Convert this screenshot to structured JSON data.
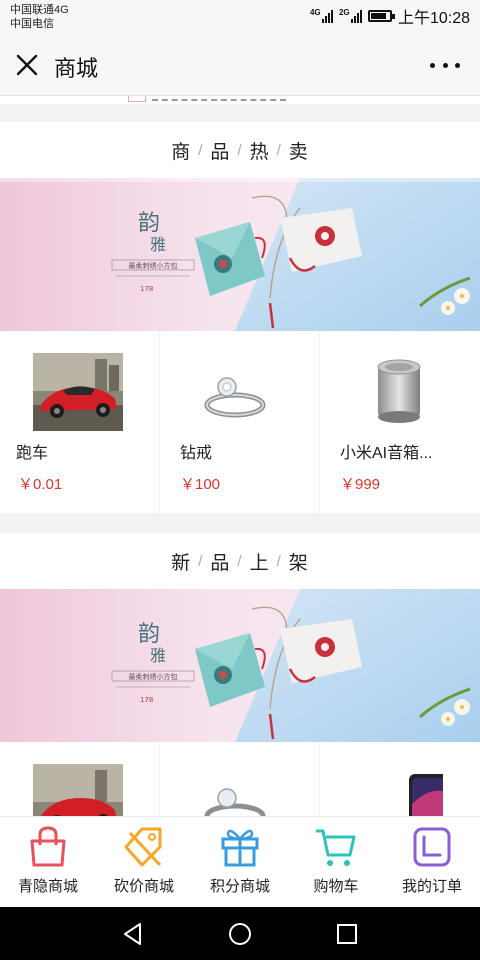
{
  "status_bar": {
    "carrier_1": "中国联通4G",
    "carrier_2": "中国电信",
    "signal_1": "4G",
    "signal_2": "2G",
    "battery_level": 0.85,
    "time": "上午10:28"
  },
  "header": {
    "title": "商城",
    "close_icon": "close-icon",
    "more_icon": "more-dots-icon"
  },
  "sections": [
    {
      "title": [
        "商",
        "品",
        "热",
        "卖"
      ],
      "banner": {
        "main_text": "韵雅",
        "sub_text": "最柔刺绣小方包",
        "price_tag": "178"
      },
      "products": [
        {
          "name": "跑车",
          "price": "￥0.01",
          "image": "red-sports-car"
        },
        {
          "name": "钻戒",
          "price": "￥100",
          "image": "diamond-ring"
        },
        {
          "name": "小米AI音箱...",
          "price": "￥999",
          "image": "xiaomi-speaker"
        }
      ]
    },
    {
      "title": [
        "新",
        "品",
        "上",
        "架"
      ],
      "banner": {
        "main_text": "韵雅",
        "sub_text": "最柔刺绣小方包",
        "price_tag": "178"
      },
      "products": [
        {
          "name": "",
          "price": "",
          "image": "red-sports-car"
        },
        {
          "name": "",
          "price": "",
          "image": "diamond-ring"
        },
        {
          "name": "",
          "price": "",
          "image": "iphone-x"
        }
      ]
    }
  ],
  "tabbar": {
    "items": [
      {
        "label": "青隐商城",
        "icon": "shopping-bag-icon",
        "color": "#e8505b"
      },
      {
        "label": "砍价商城",
        "icon": "price-tag-icon",
        "color": "#f5a623"
      },
      {
        "label": "积分商城",
        "icon": "gift-icon",
        "color": "#3a9be0"
      },
      {
        "label": "购物车",
        "icon": "cart-icon",
        "color": "#2cc4b8"
      },
      {
        "label": "我的订单",
        "icon": "order-icon",
        "color": "#8a5cd8"
      }
    ]
  },
  "colors": {
    "price": "#e0342f"
  }
}
